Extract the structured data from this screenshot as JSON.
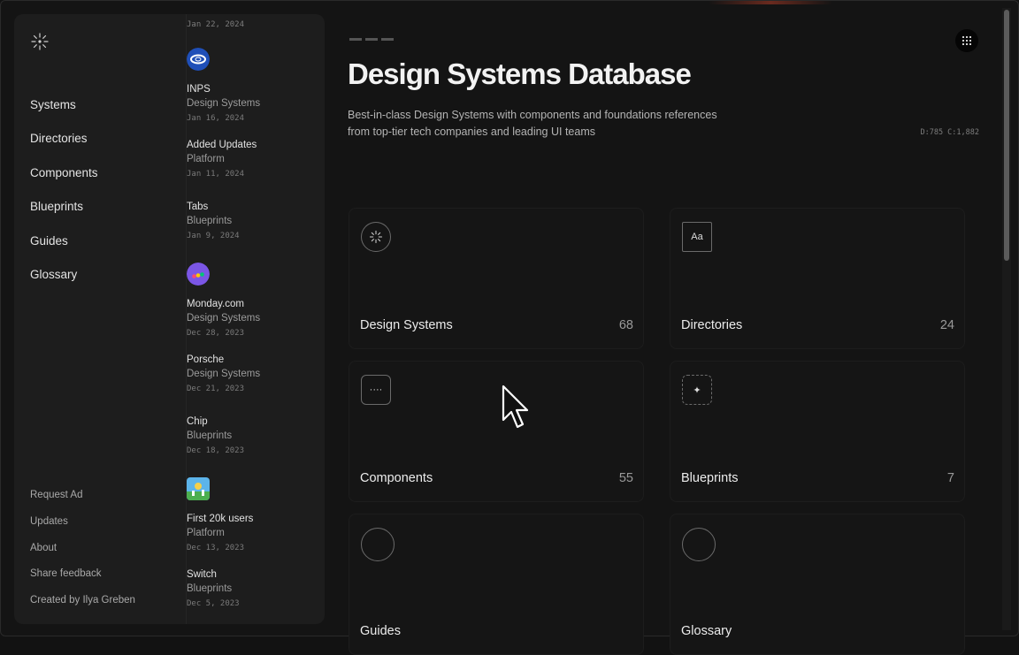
{
  "sidebar": {
    "nav": [
      "Systems",
      "Directories",
      "Components",
      "Blueprints",
      "Guides",
      "Glossary"
    ],
    "footer": [
      "Request Ad",
      "Updates",
      "About",
      "Share feedback",
      "Created by Ilya Greben"
    ]
  },
  "feed": {
    "top_date": "Jan 22, 2024",
    "items": [
      {
        "title": "INPS",
        "category": "Design Systems",
        "date": "Jan 16, 2024",
        "icon": "inps-logo-icon"
      },
      {
        "title": "Added Updates",
        "category": "Platform",
        "date": "Jan 11, 2024"
      },
      {
        "title": "Tabs",
        "category": "Blueprints",
        "date": "Jan 9, 2024"
      },
      {
        "title": "Monday.com",
        "category": "Design Systems",
        "date": "Dec 28, 2023",
        "icon": "monday-logo-icon"
      },
      {
        "title": "Porsche",
        "category": "Design Systems",
        "date": "Dec 21, 2023"
      },
      {
        "title": "Chip",
        "category": "Blueprints",
        "date": "Dec 18, 2023"
      },
      {
        "title": "First 20k users",
        "category": "Platform",
        "date": "Dec 13, 2023",
        "icon": "celebration-image-icon"
      },
      {
        "title": "Switch",
        "category": "Blueprints",
        "date": "Dec 5, 2023"
      }
    ]
  },
  "main": {
    "title": "Design Systems Database",
    "subtitle": "Best-in-class Design Systems with components and foundations references from top-tier tech companies and leading UI teams",
    "stats": "D:785  C:1,882",
    "cards": [
      {
        "label": "Design Systems",
        "count": "68",
        "icon": "sparkle-circle-icon"
      },
      {
        "label": "Directories",
        "count": "24",
        "icon": "text-box-icon",
        "icon_text": "Aa"
      },
      {
        "label": "Components",
        "count": "55",
        "icon": "dots-box-icon",
        "icon_text": "····"
      },
      {
        "label": "Blueprints",
        "count": "7",
        "icon": "star-box-icon",
        "icon_text": "✦"
      },
      {
        "label": "Guides",
        "count": "",
        "icon": "circle-icon"
      },
      {
        "label": "Glossary",
        "count": "",
        "icon": "circle-icon"
      }
    ]
  }
}
